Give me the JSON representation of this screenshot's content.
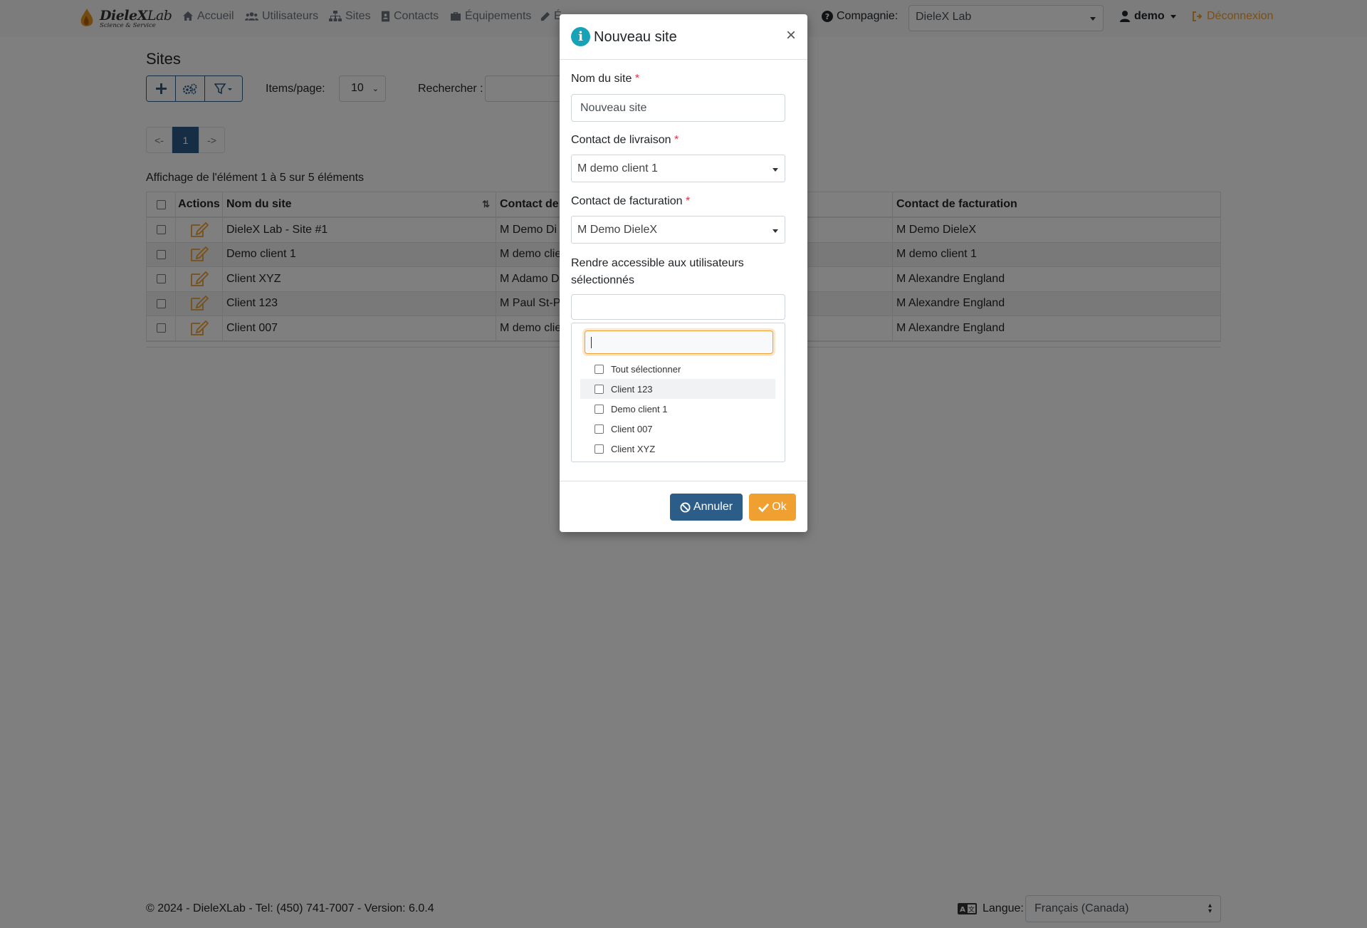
{
  "brand": {
    "name": "DieleX",
    "name_suffix": "Lab",
    "tagline": "Science & Service"
  },
  "nav": {
    "items": [
      {
        "label": "Accueil",
        "icon": "home-icon"
      },
      {
        "label": "Utilisateurs",
        "icon": "users-icon"
      },
      {
        "label": "Sites",
        "icon": "sitemap-icon"
      },
      {
        "label": "Contacts",
        "icon": "address-book-icon"
      },
      {
        "label": "Équipements",
        "icon": "briefcase-icon"
      },
      {
        "label": "É",
        "icon": "pencil-icon"
      }
    ],
    "company_label": "Compagnie:",
    "company_value": "DieleX Lab",
    "user": "demo",
    "logout": "Déconnexion"
  },
  "page": {
    "title": "Sites",
    "items_per_page_label": "Items/page:",
    "items_per_page_value": "10",
    "search_label": "Rechercher :",
    "pagination": [
      "<-",
      "1",
      "->"
    ],
    "summary": "Affichage de l'élément 1 à 5 sur 5 éléments"
  },
  "grid": {
    "headers": {
      "actions": "Actions",
      "name": "Nom du site",
      "shipping": "Contact de",
      "billing": "Contact de facturation"
    },
    "rows": [
      {
        "name": "DieleX Lab - Site #1",
        "shipping": "M Demo Di",
        "billing": "M Demo DieleX"
      },
      {
        "name": "Demo client 1",
        "shipping": "M demo clie",
        "billing": "M demo client 1"
      },
      {
        "name": "Client XYZ",
        "shipping": "M Adamo D",
        "billing": "M Alexandre England"
      },
      {
        "name": "Client 123",
        "shipping": "M Paul St-P",
        "billing": "M Alexandre England"
      },
      {
        "name": "Client 007",
        "shipping": "M demo clie",
        "billing": "M Alexandre England"
      }
    ]
  },
  "modal": {
    "title": "Nouveau site",
    "close": "×",
    "site_name_label": "Nom du site",
    "site_name_value": "Nouveau site",
    "required_mark": "*",
    "shipping_label": "Contact de livraison",
    "shipping_value": "M demo client 1",
    "billing_label": "Contact de facturation",
    "billing_value": "M Demo DieleX",
    "access_label": "Rendre accessible aux utilisateurs sélectionnés",
    "options": [
      "Tout sélectionner",
      "Client 123",
      "Demo client 1",
      "Client 007",
      "Client XYZ"
    ],
    "cancel": "Annuler",
    "ok": "Ok"
  },
  "footer": {
    "text": "© 2024 - DieleXLab - Tel: (450) 741-7007 - Version: 6.0.4",
    "lang_label": "Langue:",
    "lang_value": "Français (Canada)"
  },
  "colors": {
    "primary": "#2c5d89",
    "accent": "#f0a030",
    "info": "#17a2b8",
    "danger": "#dc3545"
  }
}
